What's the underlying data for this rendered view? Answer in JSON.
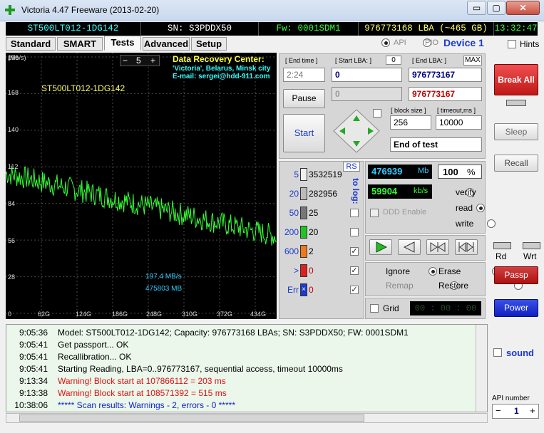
{
  "window": {
    "title": "Victoria 4.47  Freeware (2013-02-20)",
    "minimize": "▭",
    "maximize": "▢",
    "close": "✕"
  },
  "infobar": {
    "model": "ST500LT012-1DG142",
    "serial": "SN: S3PDDX50",
    "firmware": "Fw: 0001SDM1",
    "lba": "976773168 LBA (~465 GB)",
    "clock": "13:32:47"
  },
  "tabs": [
    "Standard",
    "SMART",
    "Tests",
    "Advanced",
    "Setup"
  ],
  "mode": {
    "api": "API",
    "pio": "PIO",
    "device": "Device 1",
    "hints": "Hints"
  },
  "graph": {
    "unit": "(Mb/s)",
    "model_label": "ST500LT012-1DG142",
    "step_minus": "−",
    "step_value": "5",
    "step_plus": "+",
    "promo_line1": "Data Recovery Center:",
    "promo_line2": "'Victoria', Belarus, Minsk city",
    "promo_line3": "E-mail: sergei@hdd-911.com",
    "speed_readout": "197,4 MB/s",
    "pos_readout": "475803 MB",
    "yticks": [
      "196",
      "168",
      "140",
      "112",
      "84",
      "56",
      "28",
      "0"
    ],
    "xticks": [
      "0",
      "62G",
      "124G",
      "186G",
      "248G",
      "310G",
      "372G",
      "434G"
    ]
  },
  "test": {
    "end_time_label": "[ End time ]",
    "end_time_value": "2:24",
    "start_lba_label": "[ Start LBA: ]",
    "start_lba_zero": "0",
    "start_lba_value": "0",
    "start_lba_disabled": "0",
    "end_lba_label": "[ End LBA: ]",
    "max_btn": "MAX",
    "end_lba_value": "976773167",
    "end_lba_value2": "976773167",
    "pause_btn": "Pause",
    "start_btn": "Start",
    "block_size_label": "[ block size ]",
    "block_size_value": "256",
    "timeout_label": "[ timeout,ms ]",
    "timeout_value": "10000",
    "end_action": "End of test"
  },
  "blocks": {
    "rs": "RS",
    "to_log": "to log:",
    "rows": [
      {
        "t": "5",
        "count": "3532519",
        "color": "#f0f0f0"
      },
      {
        "t": "20",
        "count": "282956",
        "color": "#bbbbbb"
      },
      {
        "t": "50",
        "count": "25",
        "color": "#777777"
      },
      {
        "t": "200",
        "count": "20",
        "color": "#22c322"
      },
      {
        "t": "600",
        "count": "2",
        "color": "#f07a1a"
      },
      {
        "t": ">",
        "count": "0",
        "color": "#e02020"
      },
      {
        "t": "Err",
        "count": "0",
        "color": "#1a3ad0"
      }
    ]
  },
  "stats": {
    "mb": "476939",
    "mb_unit": "Mb",
    "pct": "100",
    "pct_unit": "%",
    "kbs": "59904",
    "kbs_unit": "kb/s",
    "ddd": "DDD Enable"
  },
  "op": {
    "verify": "verify",
    "read": "read",
    "write": "write"
  },
  "action": {
    "ignore": "Ignore",
    "erase": "Erase",
    "remap": "Remap",
    "restore": "Restore",
    "grid": "Grid",
    "timer": "00 : 00 : 00"
  },
  "side": {
    "break": "Break All",
    "sleep": "Sleep",
    "recall": "Recall",
    "rd": "Rd",
    "wrt": "Wrt",
    "passp": "Passp",
    "power": "Power",
    "sound": "sound",
    "api_number": "API number",
    "api_value": "1",
    "minus": "−",
    "plus": "+"
  },
  "log": [
    {
      "time": "9:05:36",
      "text": "Model: ST500LT012-1DG142; Capacity: 976773168 LBAs; SN: S3PDDX50; FW: 0001SDM1",
      "color": "#000000"
    },
    {
      "time": "9:05:41",
      "text": "Get passport... OK",
      "color": "#000000"
    },
    {
      "time": "9:05:41",
      "text": "Recallibration... OK",
      "color": "#000000"
    },
    {
      "time": "9:05:41",
      "text": "Starting Reading, LBA=0..976773167, sequential access, timeout 10000ms",
      "color": "#000000"
    },
    {
      "time": "9:13:34",
      "text": "Warning! Block start at 107866112 = 203 ms",
      "color": "#e01010"
    },
    {
      "time": "9:13:38",
      "text": "Warning! Block start at 108571392 = 515 ms",
      "color": "#e01010"
    },
    {
      "time": "10:38:06",
      "text": "***** Scan results: Warnings - 2, errors - 0 *****",
      "color": "#1020d0"
    }
  ],
  "colors": {
    "green": "#33ff33",
    "yellow": "#ffff33",
    "cyan": "#33ffff",
    "field_red": "#c00000",
    "field_blue": "#000080"
  }
}
